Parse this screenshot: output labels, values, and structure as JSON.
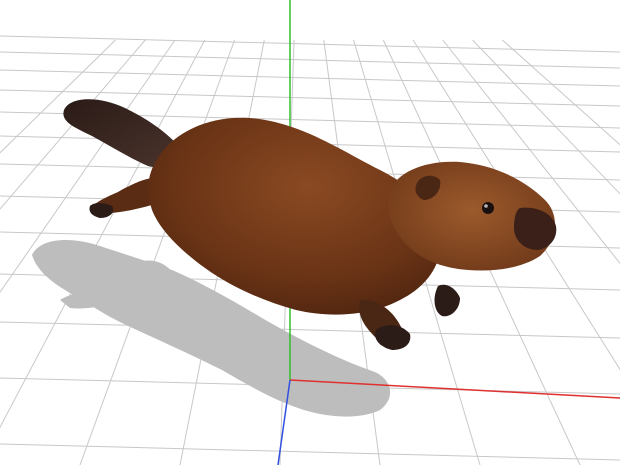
{
  "scene": {
    "background_color": "#ffffff",
    "grid_color": "#c8c8c8",
    "axis_colors": {
      "x_axis": "#e03030",
      "y_axis": "#30c030",
      "z_axis": "#3050e0"
    },
    "shadow_color": "#bdbdbd",
    "model": {
      "icon": "beaver-model",
      "fur_color": "#6b3416",
      "fur_highlight": "#9a5a2c",
      "tail_color": "#3a2620",
      "paw_color": "#2b1c18",
      "eye_color": "#1a1010"
    }
  }
}
